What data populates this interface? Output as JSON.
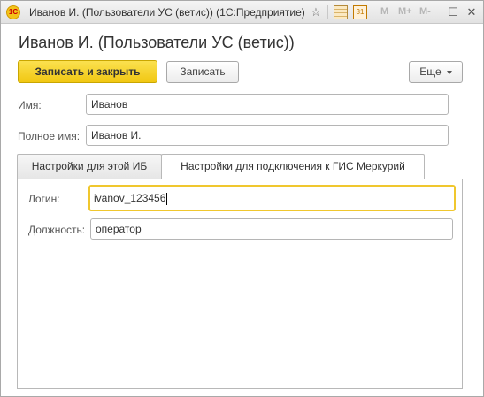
{
  "window": {
    "title": "Иванов И. (Пользователи УС (ветис))  (1С:Предприятие)",
    "logo_text": "1С",
    "toolbar_icons": [
      "star-icon",
      "calculator-icon",
      "calendar-icon"
    ],
    "calendar_day": "31",
    "memory_buttons": [
      "M",
      "M+",
      "M-"
    ],
    "controls": {
      "minimize": "—",
      "maximize": "☐",
      "close": "✕"
    }
  },
  "form": {
    "title": "Иванов И. (Пользователи УС (ветис))"
  },
  "commands": {
    "save_and_close": "Записать и закрыть",
    "save": "Записать",
    "more": "Еще"
  },
  "fields": {
    "name": {
      "label": "Имя:",
      "value": "Иванов"
    },
    "full_name": {
      "label": "Полное имя:",
      "value": "Иванов И."
    }
  },
  "tabs": [
    {
      "label": "Настройки для этой ИБ",
      "active": false
    },
    {
      "label": "Настройки для подключения к ГИС Меркурий",
      "active": true
    }
  ],
  "mercury": {
    "login": {
      "label": "Логин:",
      "value": "ivanov_123456"
    },
    "position": {
      "label": "Должность:",
      "value": "оператор"
    }
  },
  "colors": {
    "accent": "#f1c712",
    "focus_border": "#f0c72e"
  }
}
